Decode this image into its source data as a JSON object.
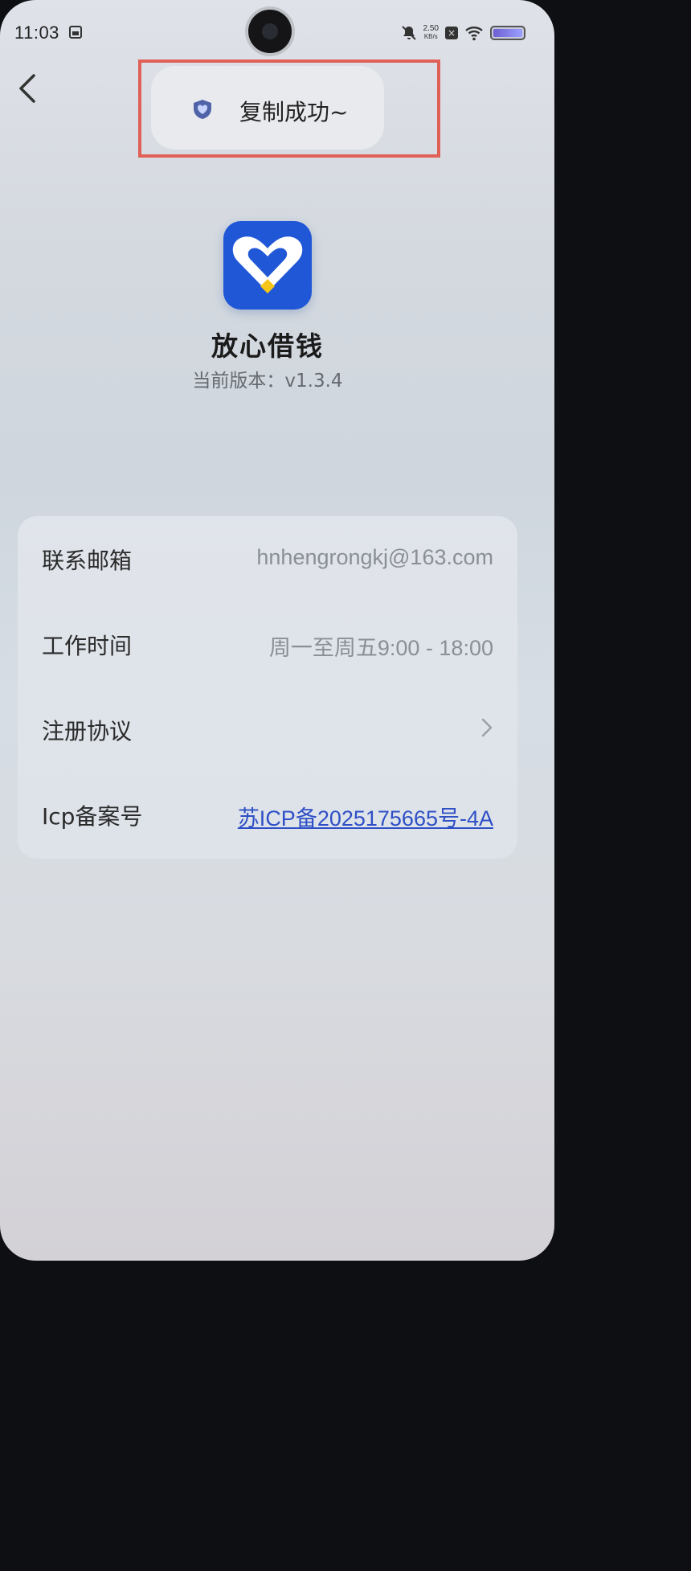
{
  "status_bar": {
    "time": "11:03",
    "net_speed_value": "2.50",
    "net_speed_unit": "KB/s",
    "icons": [
      "sim-card-icon",
      "bell-off-icon",
      "x-badge-icon",
      "wifi-icon",
      "battery-icon"
    ]
  },
  "toast": {
    "text": "复制成功~",
    "icon": "shield-heart-icon"
  },
  "app": {
    "name": "放心借钱",
    "version": "当前版本：v1.3.4",
    "brand_color": "#1f57d6"
  },
  "info": {
    "rows": [
      {
        "label": "联系邮箱",
        "value": "hnhengrongkj@163.com"
      },
      {
        "label": "工作时间",
        "value": "周一至周五9:00 - 18:00"
      },
      {
        "label": "注册协议",
        "value": ""
      },
      {
        "label": "Icp备案号",
        "value": "苏ICP备2025175665号-4A"
      }
    ]
  },
  "colors": {
    "link": "#2f4fc6",
    "highlight_box": "#e06057"
  }
}
